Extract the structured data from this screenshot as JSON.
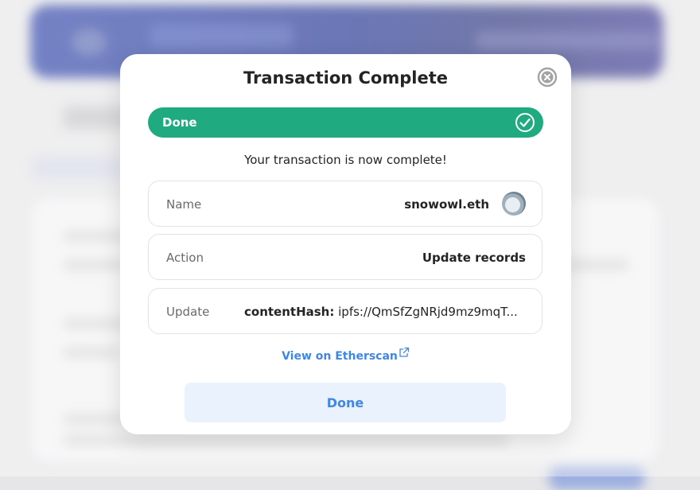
{
  "modal": {
    "title": "Transaction Complete",
    "status_label": "Done",
    "message": "Your transaction is now complete!",
    "rows": {
      "name": {
        "label": "Name",
        "value": "snowowl.eth"
      },
      "action": {
        "label": "Action",
        "value": "Update records"
      },
      "update": {
        "label": "Update",
        "key": "contentHash:",
        "value": "ipfs://QmSfZgNRjd9mz9mqT..."
      }
    },
    "etherscan_link": "View on Etherscan",
    "done_button": "Done"
  },
  "icons": {
    "close": "close-circle-icon",
    "status": "check-circle-icon",
    "external": "external-link-icon",
    "avatar": "avatar"
  },
  "colors": {
    "success": "#1faa7f",
    "accent": "#3f87e2",
    "button_bg": "#eaf2fd"
  }
}
